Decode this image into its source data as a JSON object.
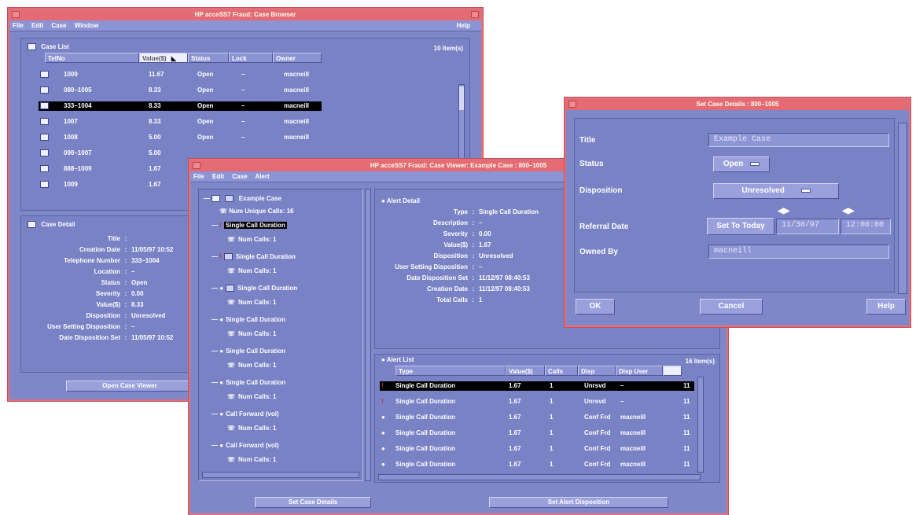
{
  "browser": {
    "title": "HP acceSS7 Fraud: Case Browser",
    "menu": [
      "File",
      "Edit",
      "Case",
      "Window"
    ],
    "help": "Help",
    "case_list": {
      "title": "Case List",
      "count": "10 Item(s)",
      "columns": [
        "TelNo",
        "Value($)",
        "Status",
        "Lock",
        "Owner"
      ],
      "rows": [
        {
          "telno": "1009",
          "value": "11.67",
          "status": "Open",
          "lock": "–",
          "owner": "macneill"
        },
        {
          "telno": "080–1005",
          "value": "8.33",
          "status": "Open",
          "lock": "–",
          "owner": "macneill"
        },
        {
          "telno": "333–1004",
          "value": "8.33",
          "status": "Open",
          "lock": "–",
          "owner": "macneill"
        },
        {
          "telno": "1007",
          "value": "8.33",
          "status": "Open",
          "lock": "–",
          "owner": "macneill"
        },
        {
          "telno": "1008",
          "value": "5.00",
          "status": "Open",
          "lock": "–",
          "owner": "macneill"
        },
        {
          "telno": "090–1007",
          "value": "5.00",
          "status": "",
          "lock": "",
          "owner": ""
        },
        {
          "telno": "888–1009",
          "value": "1.67",
          "status": "",
          "lock": "",
          "owner": ""
        },
        {
          "telno": "1009",
          "value": "1.67",
          "status": "",
          "lock": "",
          "owner": ""
        }
      ]
    },
    "case_detail": {
      "title": "Case Detail",
      "fields": [
        {
          "k": "Title",
          "v": ""
        },
        {
          "k": "Creation Date",
          "v": "11/05/97 10:52"
        },
        {
          "k": "Telephone Number",
          "v": "333–1004"
        },
        {
          "k": "Location",
          "v": "–"
        },
        {
          "k": "Status",
          "v": "Open"
        },
        {
          "k": "Severity",
          "v": "0.00"
        },
        {
          "k": "Value($)",
          "v": "8.33"
        },
        {
          "k": "Disposition",
          "v": "Unresolved"
        },
        {
          "k": "User Setting Disposition",
          "v": "–"
        },
        {
          "k": "Date Disposition Set",
          "v": "11/05/97 10:52"
        }
      ]
    },
    "open_viewer": "Open Case Viewer"
  },
  "viewer": {
    "title": "HP acceSS7 Fraud: Case Viewer: Example Case : 800–1005",
    "menu": [
      "File",
      "Edit",
      "Case",
      "Alert"
    ],
    "tree": {
      "root": "Example Case",
      "unique": "Num Unique Calls: 16",
      "items": [
        {
          "label": "Single Call Duration",
          "calls": "Num Calls: 1",
          "icon": "excl",
          "sel": true
        },
        {
          "label": "Single Call Duration",
          "calls": "Num Calls: 1",
          "icon": "excl-box"
        },
        {
          "label": "Single Call Duration",
          "calls": "Num Calls: 1",
          "icon": "bulb-box"
        },
        {
          "label": "Single Call Duration",
          "calls": "Num Calls: 1",
          "icon": "bulb"
        },
        {
          "label": "Single Call Duration",
          "calls": "Num Calls: 1",
          "icon": "bulb"
        },
        {
          "label": "Single Call Duration",
          "calls": "Num Calls: 1",
          "icon": "bulb"
        },
        {
          "label": "Call Forward (vol)",
          "calls": "Num Calls: 1",
          "icon": "bulb"
        },
        {
          "label": "Call Forward (vol)",
          "calls": "Num Calls: 1",
          "icon": "bulb"
        }
      ]
    },
    "alert_detail": {
      "title": "Alert Detail",
      "fields": [
        {
          "k": "Type",
          "v": "Single Call Duration"
        },
        {
          "k": "Description",
          "v": "–"
        },
        {
          "k": "Severity",
          "v": "0.00"
        },
        {
          "k": "Value($)",
          "v": "1.67"
        },
        {
          "k": "Disposition",
          "v": "Unresolved"
        },
        {
          "k": "User Setting Disposition",
          "v": "–"
        },
        {
          "k": "Date Disposition Set",
          "v": "11/12/97 08:40:53"
        },
        {
          "k": "Creation Date",
          "v": "11/12/97 08:40:53"
        },
        {
          "k": "Total Calls",
          "v": "1"
        }
      ]
    },
    "alert_list": {
      "title": "Alert List",
      "count": "16 Item(s)",
      "columns": [
        "Type",
        "Value($)",
        "Calls",
        "Disp",
        "Disp User"
      ],
      "rows": [
        {
          "type": "Single Call Duration",
          "value": "1.67",
          "calls": "1",
          "disp": "Unrsvd",
          "user": "–",
          "extra": "11",
          "icon": "excl"
        },
        {
          "type": "Single Call Duration",
          "value": "1.67",
          "calls": "1",
          "disp": "Unrsvd",
          "user": "–",
          "extra": "11",
          "icon": "excl"
        },
        {
          "type": "Single Call Duration",
          "value": "1.67",
          "calls": "1",
          "disp": "Conf Frd",
          "user": "macneill",
          "extra": "11",
          "icon": "bulb"
        },
        {
          "type": "Single Call Duration",
          "value": "1.67",
          "calls": "1",
          "disp": "Conf Frd",
          "user": "macneill",
          "extra": "11",
          "icon": "bulb"
        },
        {
          "type": "Single Call Duration",
          "value": "1.67",
          "calls": "1",
          "disp": "Conf Frd",
          "user": "macneill",
          "extra": "11",
          "icon": "bulb"
        },
        {
          "type": "Single Call Duration",
          "value": "1.67",
          "calls": "1",
          "disp": "Conf Frd",
          "user": "macneill",
          "extra": "11",
          "icon": "bulb"
        }
      ]
    },
    "set_case": "Set Case Details",
    "set_alert": "Set Alert Disposition"
  },
  "dialog": {
    "title": "Set Case Details : 800–1005",
    "title_label": "Title",
    "title_value": "Example Case",
    "status_label": "Status",
    "status_value": "Open",
    "disposition_label": "Disposition",
    "disposition_value": "Unresolved",
    "referral_label": "Referral Date",
    "set_today": "Set To Today",
    "date": "11/30/97",
    "time": "12:00:00",
    "owned_label": "Owned By",
    "owned_value": "macneill",
    "ok": "OK",
    "cancel": "Cancel",
    "help": "Help"
  }
}
